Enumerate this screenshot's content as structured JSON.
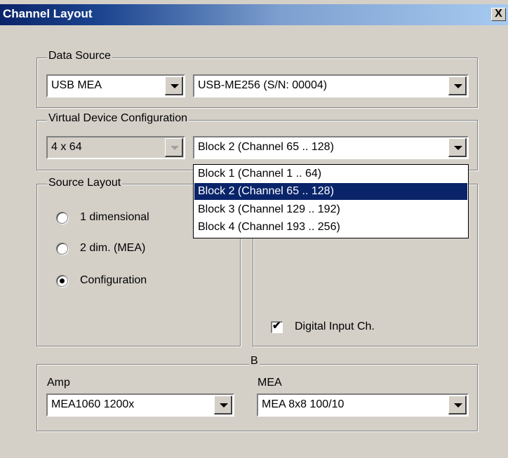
{
  "window": {
    "title": "Channel Layout",
    "close_label": "X"
  },
  "data_source": {
    "legend": "Data Source",
    "type_value": "USB MEA",
    "device_value": "USB-ME256  (S/N: 00004)"
  },
  "virtual_device": {
    "legend": "Virtual Device Configuration",
    "config_value": "4 x 64",
    "block_value": "Block 2 (Channel 65 .. 128)",
    "dropdown_options": [
      "Block 1 (Channel 1 .. 64)",
      "Block 2 (Channel 65 .. 128)",
      "Block 3 (Channel 129 .. 192)",
      "Block 4 (Channel 193 .. 256)"
    ]
  },
  "source_layout": {
    "legend": "Source Layout",
    "options": [
      "1 dimensional",
      "2 dim. (MEA)",
      "Configuration"
    ],
    "selected": "Configuration"
  },
  "right_panel": {
    "digital_input_label": "Digital Input Ch.",
    "digital_input_checked": true
  },
  "bottom": {
    "legend": "B",
    "amp_label": "Amp",
    "amp_value": "MEA1060 1200x",
    "mea_label": "MEA",
    "mea_value": "MEA 8x8 100/10"
  },
  "colors": {
    "title_active": "#0a246a",
    "selection": "#0a246a",
    "face": "#d4d0c8"
  },
  "icons": {
    "dropdown_arrow": "triangle-down",
    "close": "x-mark"
  }
}
